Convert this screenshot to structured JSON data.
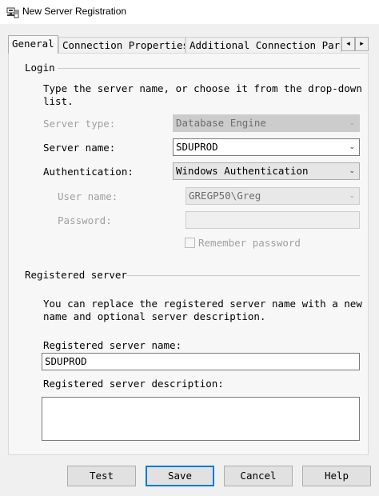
{
  "window": {
    "title": "New Server Registration"
  },
  "tabs": [
    {
      "label": "General"
    },
    {
      "label": "Connection Properties"
    },
    {
      "label": "Additional Connection Parameters"
    }
  ],
  "login": {
    "group_label": "Login",
    "instructions": [
      "Type the server name, or choose it from the drop-down",
      "list."
    ],
    "server_type": {
      "label": "Server type:",
      "value": "Database Engine"
    },
    "server_name": {
      "label": "Server name:",
      "value": "SDUPROD"
    },
    "authentication": {
      "label": "Authentication:",
      "value": "Windows Authentication"
    },
    "user_name": {
      "label": "User name:",
      "value": "GREGP50\\Greg"
    },
    "password": {
      "label": "Password:",
      "value": ""
    },
    "remember_password": {
      "label": "Remember password",
      "checked": false
    }
  },
  "registered": {
    "group_label": "Registered server",
    "instructions": [
      "You can replace the registered server name with a new",
      "name and optional server description."
    ],
    "name_label": "Registered server name:",
    "name_value": "SDUPROD",
    "description_label": "Registered server description:",
    "description_value": ""
  },
  "buttons": {
    "test": "Test",
    "save": "Save",
    "cancel": "Cancel",
    "help": "Help"
  },
  "icons": {
    "window_icon": "server-registration-icon",
    "scroll_left": "◂",
    "scroll_right": "▸",
    "dropdown": "⌄"
  },
  "colors": {
    "default_button_border": "#0078d7",
    "panel_bg": "#f7f7f7",
    "dialog_bg": "#f0f0f0"
  }
}
